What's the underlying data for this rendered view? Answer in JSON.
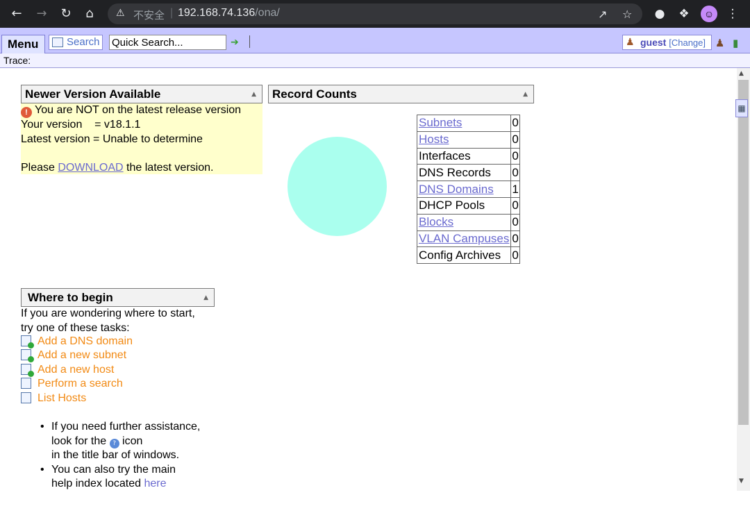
{
  "browser": {
    "security_label": "不安全",
    "url_host": "192.168.74.136",
    "url_path": "/ona/"
  },
  "appbar": {
    "menu_label": "Menu",
    "search_label": "Search",
    "quick_search_value": "Quick Search...",
    "user_name": "guest",
    "change_label": "[Change]",
    "trace_label": "Trace:"
  },
  "newer_version": {
    "title": "Newer Version Available",
    "warning": "You are NOT on the latest release version",
    "your_version": "Your version    = v18.1.1",
    "latest_version": "Latest version = Unable to determine",
    "please": "Please ",
    "download_link": "DOWNLOAD",
    "after_link": " the latest version."
  },
  "record_counts": {
    "title": "Record Counts",
    "rows": [
      {
        "label": "Subnets",
        "count": "0",
        "link": true
      },
      {
        "label": "Hosts",
        "count": "0",
        "link": true
      },
      {
        "label": "Interfaces",
        "count": "0",
        "link": false
      },
      {
        "label": "DNS Records",
        "count": "0",
        "link": false
      },
      {
        "label": "DNS Domains",
        "count": "1",
        "link": true
      },
      {
        "label": "DHCP Pools",
        "count": "0",
        "link": false
      },
      {
        "label": "Blocks",
        "count": "0",
        "link": true
      },
      {
        "label": "VLAN Campuses",
        "count": "0",
        "link": true
      },
      {
        "label": "Config Archives",
        "count": "0",
        "link": false
      }
    ],
    "pie_color": "#aaffee"
  },
  "where_to_begin": {
    "title": "Where to begin",
    "intro_line1": "If you are wondering where to start,",
    "intro_line2": "try one of these tasks:",
    "tasks": [
      {
        "label": "Add a DNS domain",
        "icon": "add-page-icon"
      },
      {
        "label": "Add a new subnet",
        "icon": "add-page-icon"
      },
      {
        "label": "Add a new host",
        "icon": "add-page-icon"
      },
      {
        "label": "Perform a search",
        "icon": "search-form-icon"
      },
      {
        "label": "List Hosts",
        "icon": "table-icon"
      }
    ],
    "bullet1_line1": "If you need further assistance,",
    "bullet1_line2a": "look for the ",
    "bullet1_line2b": " icon",
    "bullet1_line3": "in the title bar of windows.",
    "bullet2_line1": "You can also try the main",
    "bullet2_line2a": "help index located ",
    "bullet2_link": "here"
  }
}
